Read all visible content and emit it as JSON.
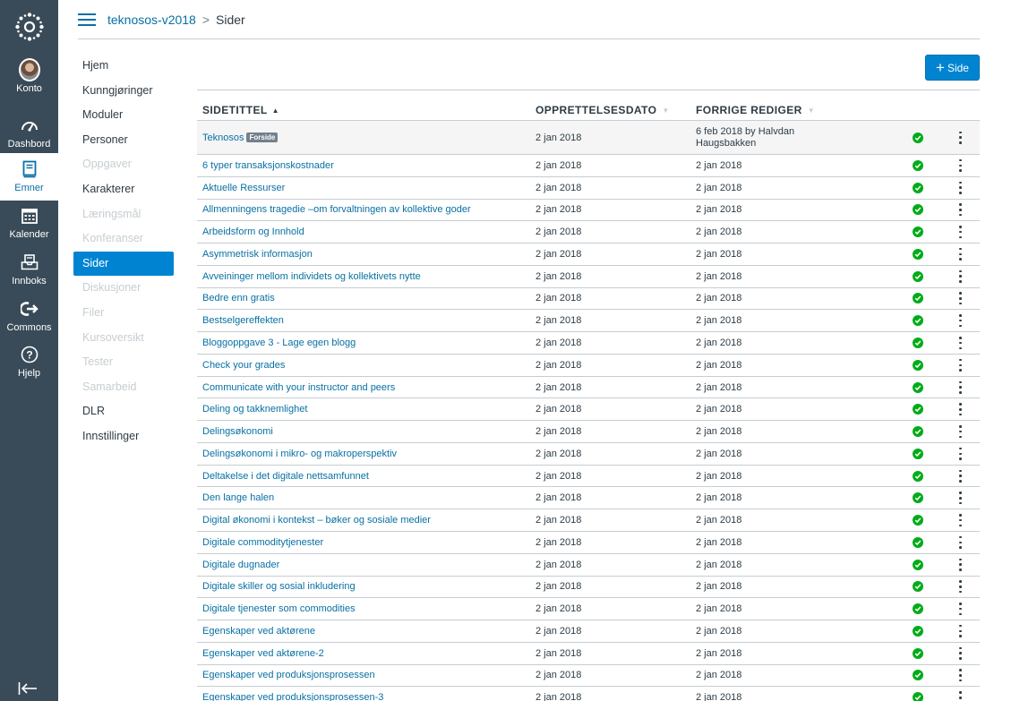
{
  "global_nav": {
    "items": [
      {
        "label": "Konto",
        "icon": "avatar"
      },
      {
        "label": "Dashbord",
        "icon": "dashboard-icon"
      },
      {
        "label": "Emner",
        "icon": "courses-icon"
      },
      {
        "label": "Kalender",
        "icon": "calendar-icon"
      },
      {
        "label": "Innboks",
        "icon": "inbox-icon"
      },
      {
        "label": "Commons",
        "icon": "commons-icon"
      },
      {
        "label": "Hjelp",
        "icon": "help-icon"
      }
    ]
  },
  "breadcrumb": {
    "course": "teknosos-v2018",
    "separator": ">",
    "current": "Sider"
  },
  "course_nav": [
    {
      "label": "Hjem",
      "state": "normal"
    },
    {
      "label": "Kunngjøringer",
      "state": "normal"
    },
    {
      "label": "Moduler",
      "state": "normal"
    },
    {
      "label": "Personer",
      "state": "normal"
    },
    {
      "label": "Oppgaver",
      "state": "hidden"
    },
    {
      "label": "Karakterer",
      "state": "normal"
    },
    {
      "label": "Læringsmål",
      "state": "hidden"
    },
    {
      "label": "Konferanser",
      "state": "hidden"
    },
    {
      "label": "Sider",
      "state": "active"
    },
    {
      "label": "Diskusjoner",
      "state": "hidden"
    },
    {
      "label": "Filer",
      "state": "hidden"
    },
    {
      "label": "Kursoversikt",
      "state": "hidden"
    },
    {
      "label": "Tester",
      "state": "hidden"
    },
    {
      "label": "Samarbeid",
      "state": "hidden"
    },
    {
      "label": "DLR",
      "state": "normal"
    },
    {
      "label": "Innstillinger",
      "state": "normal"
    }
  ],
  "add_page_button": {
    "plus": "+",
    "label": "Side"
  },
  "table": {
    "headers": {
      "title": "SIDETITTEL",
      "created": "OPPRETTELSESDATO",
      "edited": "FORRIGE REDIGER"
    },
    "front_page": {
      "title": "Teknosos",
      "badge": "Forside",
      "created": "2 jan 2018",
      "edited_line1": "6 feb 2018 by Halvdan",
      "edited_line2": "Haugsbakken"
    },
    "rows": [
      {
        "title": "6 typer transaksjonskostnader",
        "created": "2 jan 2018",
        "edited": "2 jan 2018"
      },
      {
        "title": "Aktuelle Ressurser",
        "created": "2 jan 2018",
        "edited": "2 jan 2018"
      },
      {
        "title": "Allmenningens tragedie –om forvaltningen av kollektive goder",
        "created": "2 jan 2018",
        "edited": "2 jan 2018"
      },
      {
        "title": "Arbeidsform og Innhold",
        "created": "2 jan 2018",
        "edited": "2 jan 2018"
      },
      {
        "title": "Asymmetrisk informasjon",
        "created": "2 jan 2018",
        "edited": "2 jan 2018"
      },
      {
        "title": "Avveininger mellom individets og kollektivets nytte",
        "created": "2 jan 2018",
        "edited": "2 jan 2018"
      },
      {
        "title": "Bedre enn gratis",
        "created": "2 jan 2018",
        "edited": "2 jan 2018"
      },
      {
        "title": "Bestselgereffekten",
        "created": "2 jan 2018",
        "edited": "2 jan 2018"
      },
      {
        "title": "Bloggoppgave 3 - Lage egen blogg",
        "created": "2 jan 2018",
        "edited": "2 jan 2018"
      },
      {
        "title": "Check your grades",
        "created": "2 jan 2018",
        "edited": "2 jan 2018"
      },
      {
        "title": "Communicate with your instructor and peers",
        "created": "2 jan 2018",
        "edited": "2 jan 2018"
      },
      {
        "title": "Deling og takknemlighet",
        "created": "2 jan 2018",
        "edited": "2 jan 2018"
      },
      {
        "title": "Delingsøkonomi",
        "created": "2 jan 2018",
        "edited": "2 jan 2018"
      },
      {
        "title": "Delingsøkonomi i mikro- og makroperspektiv",
        "created": "2 jan 2018",
        "edited": "2 jan 2018"
      },
      {
        "title": "Deltakelse i det digitale nettsamfunnet",
        "created": "2 jan 2018",
        "edited": "2 jan 2018"
      },
      {
        "title": "Den lange halen",
        "created": "2 jan 2018",
        "edited": "2 jan 2018"
      },
      {
        "title": "Digital økonomi i kontekst – bøker og sosiale medier",
        "created": "2 jan 2018",
        "edited": "2 jan 2018"
      },
      {
        "title": "Digitale commoditytjenester",
        "created": "2 jan 2018",
        "edited": "2 jan 2018"
      },
      {
        "title": "Digitale dugnader",
        "created": "2 jan 2018",
        "edited": "2 jan 2018"
      },
      {
        "title": "Digitale skiller og sosial inkludering",
        "created": "2 jan 2018",
        "edited": "2 jan 2018"
      },
      {
        "title": "Digitale tjenester som commodities",
        "created": "2 jan 2018",
        "edited": "2 jan 2018"
      },
      {
        "title": "Egenskaper ved aktørene",
        "created": "2 jan 2018",
        "edited": "2 jan 2018"
      },
      {
        "title": "Egenskaper ved aktørene-2",
        "created": "2 jan 2018",
        "edited": "2 jan 2018"
      },
      {
        "title": "Egenskaper ved produksjonsprosessen",
        "created": "2 jan 2018",
        "edited": "2 jan 2018"
      },
      {
        "title": "Egenskaper ved produksjonsprosessen-3",
        "created": "2 jan 2018",
        "edited": "2 jan 2018"
      }
    ]
  },
  "colors": {
    "global_nav_bg": "#394b58",
    "link": "#0770a3",
    "primary": "#0084d1",
    "published": "#00ac18",
    "border": "#c7cdd1"
  }
}
